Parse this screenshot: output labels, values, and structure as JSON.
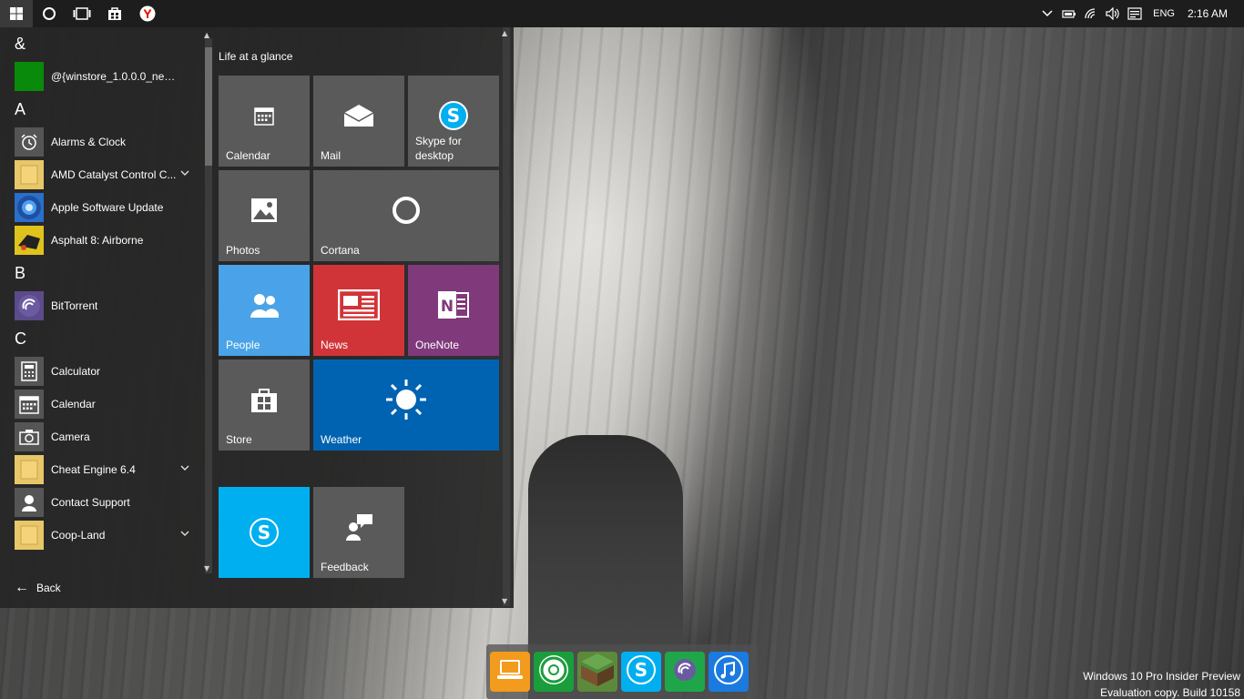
{
  "taskbar": {
    "tray": {
      "language": "ENG",
      "clock": "2:16 AM"
    }
  },
  "start_menu": {
    "app_list": [
      {
        "type": "letter",
        "label": "&"
      },
      {
        "type": "app",
        "label": "@{winstore_1.0.0.0_neutral_n...",
        "icon": "store-app-icon",
        "color": "#0a8a0a"
      },
      {
        "type": "letter",
        "label": "A"
      },
      {
        "type": "app",
        "label": "Alarms & Clock",
        "icon": "alarm-clock-icon",
        "color": "#555555"
      },
      {
        "type": "app",
        "label": "AMD Catalyst Control C...",
        "icon": "folder-icon",
        "color": "#e8c76a",
        "expand": true
      },
      {
        "type": "app",
        "label": "Apple Software Update",
        "icon": "apple-update-icon",
        "color": "#2a6fc9"
      },
      {
        "type": "app",
        "label": "Asphalt 8: Airborne",
        "icon": "asphalt-icon",
        "color": "#d4b020"
      },
      {
        "type": "letter",
        "label": "B"
      },
      {
        "type": "app",
        "label": "BitTorrent",
        "icon": "bittorrent-icon",
        "color": "#5c4b8a"
      },
      {
        "type": "letter",
        "label": "C"
      },
      {
        "type": "app",
        "label": "Calculator",
        "icon": "calculator-icon",
        "color": "#555555"
      },
      {
        "type": "app",
        "label": "Calendar",
        "icon": "calendar-icon",
        "color": "#555555"
      },
      {
        "type": "app",
        "label": "Camera",
        "icon": "camera-icon",
        "color": "#555555"
      },
      {
        "type": "app",
        "label": "Cheat Engine 6.4",
        "icon": "folder-icon",
        "color": "#e8c76a",
        "expand": true
      },
      {
        "type": "app",
        "label": "Contact Support",
        "icon": "contact-support-icon",
        "color": "#555555"
      },
      {
        "type": "app",
        "label": "Coop-Land",
        "icon": "folder-icon",
        "color": "#e8c76a",
        "expand": true
      }
    ],
    "back_label": "Back",
    "group_title": "Life at a glance",
    "tiles": [
      {
        "label": "Calendar",
        "icon": "calendar-icon",
        "color": "#5a5a5a"
      },
      {
        "label": "Mail",
        "icon": "mail-icon",
        "color": "#5a5a5a"
      },
      {
        "label": "Skype for\ndesktop",
        "icon": "skype-icon",
        "color": "#5a5a5a"
      },
      {
        "label": "Photos",
        "icon": "photos-icon",
        "color": "#5a5a5a"
      },
      {
        "label": "Cortana",
        "icon": "cortana-icon",
        "color": "#5a5a5a"
      },
      {
        "label": "People",
        "icon": "people-icon",
        "color": "#4aa3e8"
      },
      {
        "label": "News",
        "icon": "news-icon",
        "color": "#d13438"
      },
      {
        "label": "OneNote",
        "icon": "onenote-icon",
        "color": "#80397b"
      },
      {
        "label": "Store",
        "icon": "store-icon",
        "color": "#5a5a5a"
      },
      {
        "label": "Weather",
        "icon": "weather-icon",
        "color": "#0063b1"
      },
      {
        "label": "",
        "icon": "skype-icon",
        "color": "#00aff0"
      },
      {
        "label": "Feedback",
        "icon": "feedback-icon",
        "color": "#5a5a5a"
      }
    ]
  },
  "dock": [
    {
      "name": "laptop-app",
      "icon": "laptop-icon",
      "color": "#f29b1d"
    },
    {
      "name": "chrome",
      "icon": "chrome-icon",
      "color": "#1a9e3c"
    },
    {
      "name": "minecraft",
      "icon": "minecraft-icon",
      "color": "#5d8a3a"
    },
    {
      "name": "skype",
      "icon": "skype-icon",
      "color": "#00aff0"
    },
    {
      "name": "bittorrent",
      "icon": "bittorrent-icon",
      "color": "#1fa64a"
    },
    {
      "name": "itunes",
      "icon": "itunes-icon",
      "color": "#1b7ae0"
    }
  ],
  "watermark": {
    "line1": "Windows 10 Pro Insider Preview",
    "line2": "Evaluation copy. Build 10158"
  }
}
